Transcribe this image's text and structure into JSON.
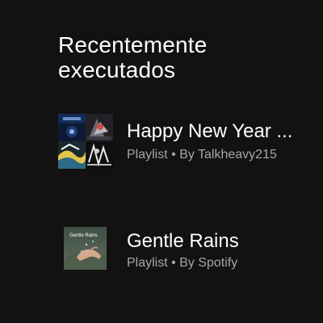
{
  "section": {
    "title_line1": "Recentemente",
    "title_line2": "executados"
  },
  "items": [
    {
      "title": "Happy New Year ...",
      "type": "Playlist",
      "separator": "•",
      "by_label": "By",
      "owner": "Talkheavy215",
      "cover_icon": "playlist-mosaic-cover"
    },
    {
      "title": "Gentle Rains",
      "type": "Playlist",
      "separator": "•",
      "by_label": "By",
      "owner": "Spotify",
      "cover_icon": "playlist-cover",
      "cover_text": "Gentle Rains"
    }
  ],
  "colors": {
    "background": "#121212",
    "primary_text": "#ffffff",
    "secondary_text": "#a7a7a7"
  }
}
